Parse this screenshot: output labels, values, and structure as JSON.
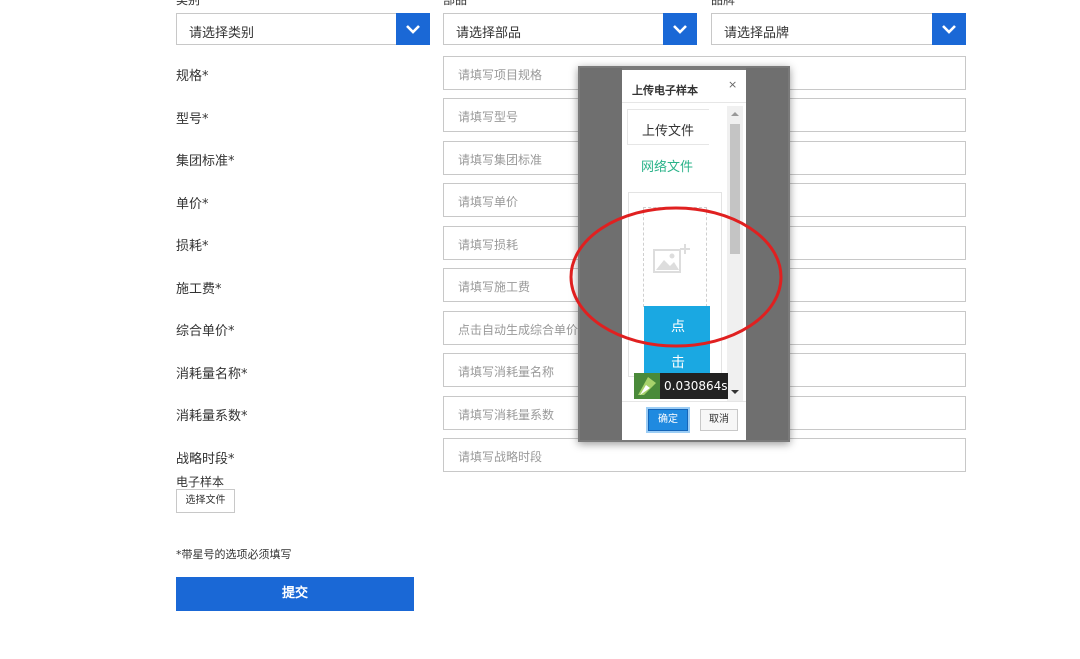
{
  "top_labels": {
    "category": "类别",
    "part": "部品",
    "brand": "品牌"
  },
  "selects": {
    "category": "请选择类别",
    "part": "请选择部品",
    "brand": "请选择品牌"
  },
  "fields": [
    {
      "label": "规格*",
      "placeholder": "请填写项目规格"
    },
    {
      "label": "型号*",
      "placeholder": "请填写型号"
    },
    {
      "label": "集团标准*",
      "placeholder": "请填写集团标准"
    },
    {
      "label": "单价*",
      "placeholder": "请填写单价"
    },
    {
      "label": "损耗*",
      "placeholder": "请填写损耗"
    },
    {
      "label": "施工费*",
      "placeholder": "请填写施工费"
    },
    {
      "label": "综合单价*",
      "placeholder": "点击自动生成综合单价"
    },
    {
      "label": "消耗量名称*",
      "placeholder": "请填写消耗量名称"
    },
    {
      "label": "消耗量系数*",
      "placeholder": "请填写消耗量系数"
    },
    {
      "label": "战略时段*",
      "placeholder": "请填写战略时段"
    }
  ],
  "sample": {
    "label": "电子样本",
    "file_button": "选择文件"
  },
  "note": "*带星号的选项必须填写",
  "submit": "提交",
  "dialog": {
    "title": "上传电子样本",
    "close": "×",
    "tab_upload": "上传文件",
    "tab_network": "网络文件",
    "click_text_1": "点",
    "click_text_2": "击",
    "ok": "确定",
    "cancel": "取消"
  },
  "timer": "0.030864s",
  "colors": {
    "primary": "#1a68d6",
    "tab_green": "#2bb38a",
    "click_blue": "#1aa8e2",
    "annotation_red": "#e02020"
  }
}
